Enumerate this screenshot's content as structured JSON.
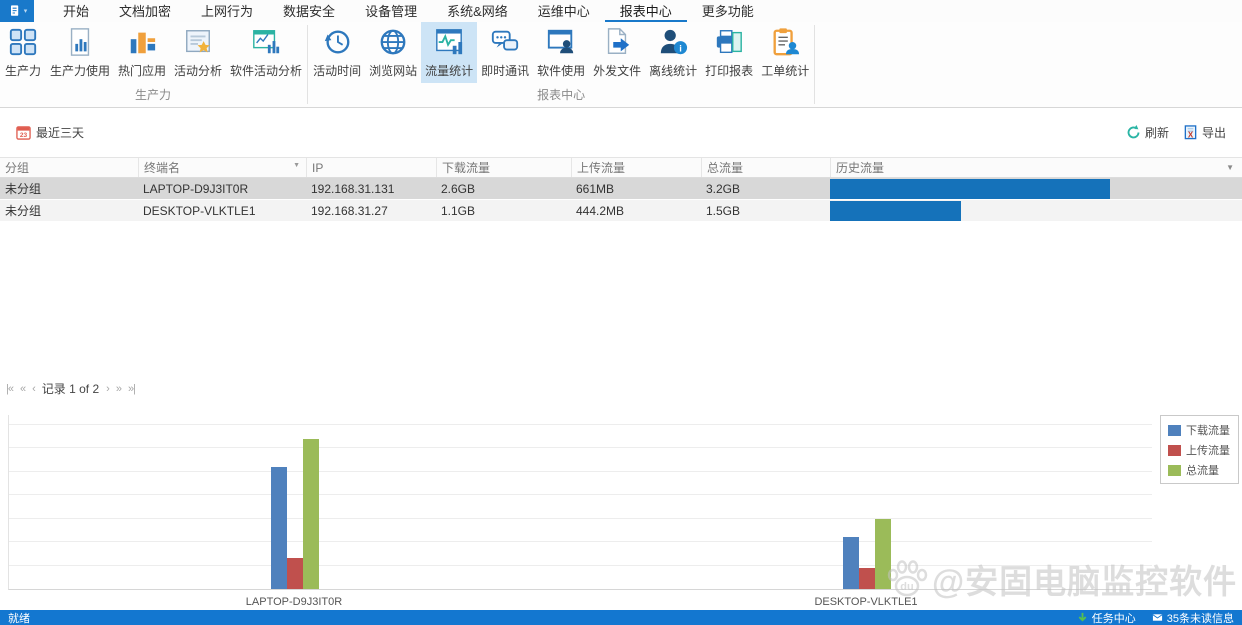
{
  "app": {
    "menu_tabs": [
      "开始",
      "文档加密",
      "上网行为",
      "数据安全",
      "设备管理",
      "系统&网络",
      "运维中心",
      "报表中心",
      "更多功能"
    ],
    "active_tab": "报表中心"
  },
  "ribbon": {
    "selected_button": "流量统计",
    "groups": [
      {
        "label": "生产力",
        "buttons": [
          {
            "label": "生产力",
            "icon": "grid"
          },
          {
            "label": "生产力使用",
            "icon": "doc-chart"
          },
          {
            "label": "热门应用",
            "icon": "hot-bars"
          },
          {
            "label": "活动分析",
            "icon": "doc-star"
          },
          {
            "label": "软件活动分析",
            "icon": "window-chart"
          }
        ]
      },
      {
        "label": "报表中心",
        "buttons": [
          {
            "label": "活动时间",
            "icon": "history-clock"
          },
          {
            "label": "浏览网站",
            "icon": "globe"
          },
          {
            "label": "流量统计",
            "icon": "traffic-pulse"
          },
          {
            "label": "即时通讯",
            "icon": "chat-bubbles"
          },
          {
            "label": "软件使用",
            "icon": "window-user"
          },
          {
            "label": "外发文件",
            "icon": "doc-arrow"
          },
          {
            "label": "离线统计",
            "icon": "user-info"
          },
          {
            "label": "打印报表",
            "icon": "printer"
          },
          {
            "label": "工单统计",
            "icon": "clipboard-user"
          }
        ]
      }
    ]
  },
  "toolbar": {
    "date_filter": "最近三天",
    "refresh_label": "刷新",
    "export_label": "导出"
  },
  "table": {
    "columns": [
      "分组",
      "终端名",
      "IP",
      "下载流量",
      "上传流量",
      "总流量",
      "历史流量"
    ],
    "rows": [
      {
        "group": "未分组",
        "terminal": "LAPTOP-D9J3IT0R",
        "ip": "192.168.31.131",
        "download": "2.6GB",
        "upload": "661MB",
        "total": "3.2GB",
        "history_gb": 3.2,
        "selected": true
      },
      {
        "group": "未分组",
        "terminal": "DESKTOP-VLKTLE1",
        "ip": "192.168.31.27",
        "download": "1.1GB",
        "upload": "444.2MB",
        "total": "1.5GB",
        "history_gb": 1.5,
        "selected": false
      }
    ]
  },
  "pager": {
    "back_buttons": [
      "|«",
      "«",
      "‹"
    ],
    "forward_buttons": [
      "›",
      "»",
      "»|"
    ],
    "record_text": "记录 1 of 2"
  },
  "chart_data": {
    "type": "bar",
    "categories": [
      "LAPTOP-D9J3IT0R",
      "DESKTOP-VLKTLE1"
    ],
    "series": [
      {
        "name": "下载流量",
        "color": "#4f81bd",
        "values": [
          2.6,
          1.1
        ]
      },
      {
        "name": "上传流量",
        "color": "#c0504d",
        "values": [
          0.66,
          0.44
        ]
      },
      {
        "name": "总流量",
        "color": "#9bbb59",
        "values": [
          3.2,
          1.5
        ]
      }
    ],
    "unit": "GB",
    "ylim": [
      0,
      3.73
    ],
    "gridline_interval": 0.5,
    "grid": "horizontal",
    "legend_position": "top-right",
    "title": "",
    "xlabel": "",
    "ylabel": ""
  },
  "status_bar": {
    "left": "就绪",
    "task_center": "任务中心",
    "messages": "35条未读信息"
  },
  "watermark": {
    "text": "@安固电脑监控软件",
    "badge": "du"
  },
  "colors": {
    "accent": "#1979ca",
    "ribbon_selected_bg": "#cde4f6",
    "history_bar": "#1572ba",
    "selected_row_bg": "#d8d8d8",
    "status_bar_bg": "#1377d0",
    "refresh_icon": "#2ab5a5"
  }
}
